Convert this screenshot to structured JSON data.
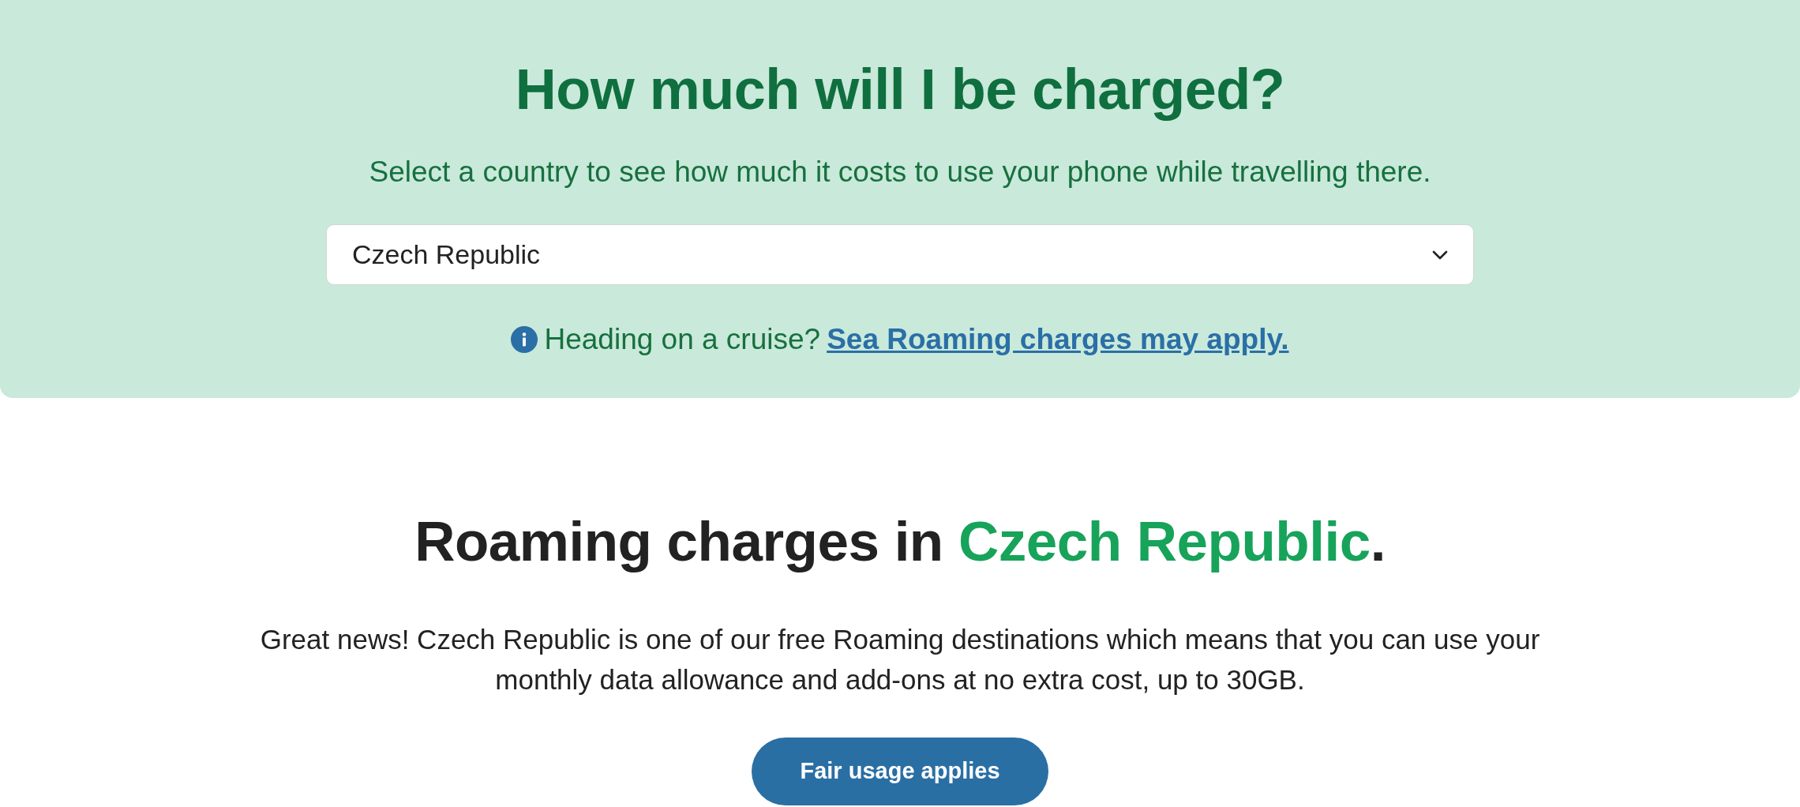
{
  "banner": {
    "title": "How much will I be charged?",
    "subtitle": "Select a country to see how much it costs to use your phone while travelling there.",
    "country_select": {
      "value": "Czech Republic"
    },
    "notice": {
      "text": "Heading on a cruise?",
      "link": "Sea Roaming charges may apply."
    }
  },
  "results": {
    "heading": {
      "text": "Roaming charges in",
      "highlight": "Czech Republic",
      "end": "."
    },
    "description": "Great news! Czech Republic is one of our free Roaming destinations which means that you can use your monthly data allowance and add-ons at no extra cost, up to 30GB.",
    "button": "Fair usage applies"
  }
}
